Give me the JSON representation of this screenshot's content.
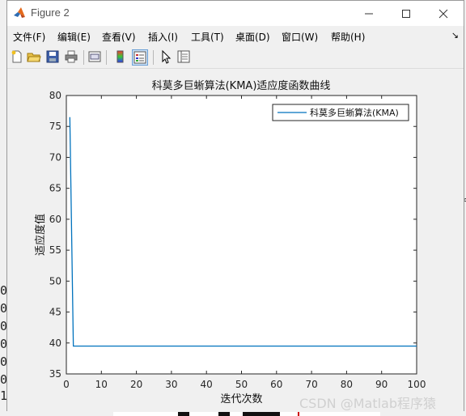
{
  "window": {
    "title": "Figure 2",
    "controls": [
      "minimize",
      "maximize",
      "close"
    ]
  },
  "menu": [
    {
      "label": "文件(F)"
    },
    {
      "label": "编辑(E)"
    },
    {
      "label": "查看(V)"
    },
    {
      "label": "插入(I)"
    },
    {
      "label": "工具(T)"
    },
    {
      "label": "桌面(D)"
    },
    {
      "label": "窗口(W)"
    },
    {
      "label": "帮助(H)"
    }
  ],
  "menu_overflow": "↘",
  "toolbar": [
    {
      "icon": "new-figure-icon"
    },
    {
      "icon": "open-file-icon"
    },
    {
      "icon": "save-icon"
    },
    {
      "icon": "print-icon"
    },
    {
      "icon": "link-plot-icon"
    },
    {
      "icon": "insert-colorbar-icon"
    },
    {
      "icon": "insert-legend-icon",
      "pressed": true
    },
    {
      "icon": "pointer-icon"
    },
    {
      "icon": "property-inspector-icon"
    }
  ],
  "background_digits": [
    "0",
    "0",
    "0",
    "0",
    "0",
    "0",
    "1"
  ],
  "watermark": "CSDN @Matlab程序猿",
  "chart_data": {
    "type": "line",
    "title": "科莫多巨蜥算法(KMA)适应度函数曲线",
    "xlabel": "迭代次数",
    "ylabel": "适应度值",
    "xlim": [
      0,
      100
    ],
    "ylim": [
      35,
      80
    ],
    "xticks": [
      0,
      10,
      20,
      30,
      40,
      50,
      60,
      70,
      80,
      90,
      100
    ],
    "yticks": [
      35,
      40,
      45,
      50,
      55,
      60,
      65,
      70,
      75,
      80
    ],
    "grid": false,
    "legend_position": "top-right",
    "colors": {
      "line": "#0072bd"
    },
    "series": [
      {
        "name": "科莫多巨蜥算法(KMA)",
        "x": [
          1,
          2,
          3,
          100
        ],
        "y": [
          76.5,
          39.5,
          39.5,
          39.5
        ]
      }
    ]
  }
}
